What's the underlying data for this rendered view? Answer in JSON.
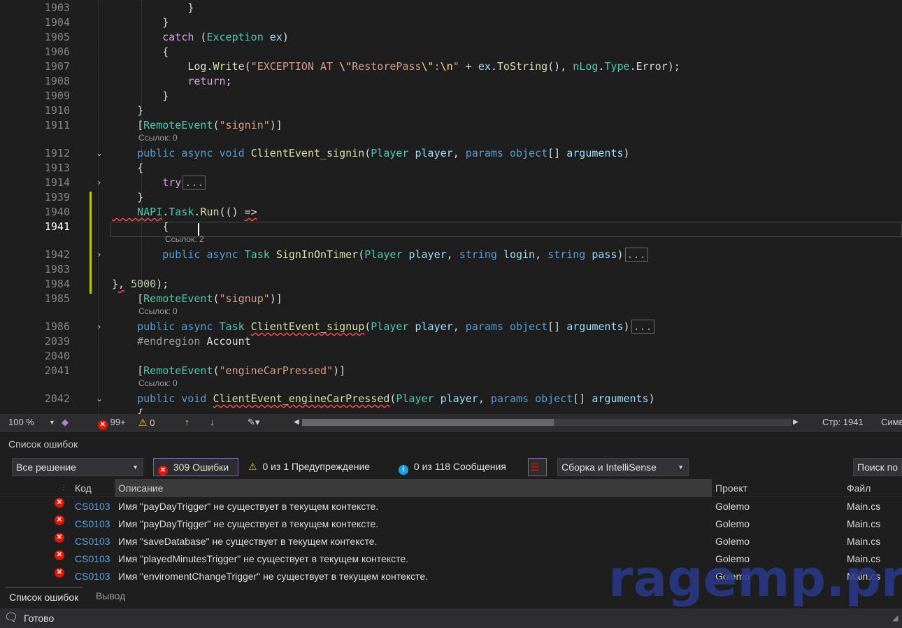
{
  "editor": {
    "lines": [
      {
        "num": "1903",
        "segments": [
          {
            "c": "w",
            "t": "            }"
          }
        ]
      },
      {
        "num": "1904",
        "segments": [
          {
            "c": "w",
            "t": "        }"
          }
        ]
      },
      {
        "num": "1905",
        "segments": [
          {
            "c": "cf",
            "t": "        catch"
          },
          {
            "c": "w",
            "t": " ("
          },
          {
            "c": "t",
            "t": "Exception"
          },
          {
            "c": "w",
            "t": " "
          },
          {
            "c": "p",
            "t": "ex"
          },
          {
            "c": "w",
            "t": ")"
          }
        ]
      },
      {
        "num": "1906",
        "segments": [
          {
            "c": "w",
            "t": "        {"
          }
        ]
      },
      {
        "num": "1907",
        "segments": [
          {
            "c": "w",
            "t": "            Log."
          },
          {
            "c": "m",
            "t": "Write"
          },
          {
            "c": "w",
            "t": "("
          },
          {
            "c": "s",
            "t": "\"EXCEPTION AT "
          },
          {
            "c": "esc",
            "t": "\\\""
          },
          {
            "c": "s",
            "t": "RestorePass"
          },
          {
            "c": "esc",
            "t": "\\\""
          },
          {
            "c": "s",
            "t": ":"
          },
          {
            "c": "esc",
            "t": "\\n"
          },
          {
            "c": "s",
            "t": "\""
          },
          {
            "c": "w",
            "t": " + "
          },
          {
            "c": "p",
            "t": "ex"
          },
          {
            "c": "w",
            "t": "."
          },
          {
            "c": "m",
            "t": "ToString"
          },
          {
            "c": "w",
            "t": "(), "
          },
          {
            "c": "t",
            "t": "nLog"
          },
          {
            "c": "w",
            "t": "."
          },
          {
            "c": "t",
            "t": "Type"
          },
          {
            "c": "w",
            "t": ".Error);"
          }
        ]
      },
      {
        "num": "1908",
        "segments": [
          {
            "c": "cf",
            "t": "            return"
          },
          {
            "c": "w",
            "t": ";"
          }
        ]
      },
      {
        "num": "1909",
        "segments": [
          {
            "c": "w",
            "t": "        }"
          }
        ]
      },
      {
        "num": "1910",
        "segments": [
          {
            "c": "w",
            "t": "    }"
          }
        ]
      },
      {
        "num": "1911",
        "segments": [
          {
            "c": "w",
            "t": "    ["
          },
          {
            "c": "t",
            "t": "RemoteEvent"
          },
          {
            "c": "w",
            "t": "("
          },
          {
            "c": "s",
            "t": "\"signin\""
          },
          {
            "c": "w",
            "t": ")]"
          }
        ]
      },
      {
        "num": "1912",
        "fold": "v",
        "segments": [
          {
            "c": "k",
            "t": "    public async void"
          },
          {
            "c": "w",
            "t": " "
          },
          {
            "c": "m",
            "t": "ClientEvent_signin"
          },
          {
            "c": "w",
            "t": "("
          },
          {
            "c": "t",
            "t": "Player"
          },
          {
            "c": "w",
            "t": " "
          },
          {
            "c": "p",
            "t": "player"
          },
          {
            "c": "w",
            "t": ", "
          },
          {
            "c": "k",
            "t": "params object"
          },
          {
            "c": "w",
            "t": "[] "
          },
          {
            "c": "p",
            "t": "arguments"
          },
          {
            "c": "w",
            "t": ")"
          }
        ]
      },
      {
        "num": "1913",
        "segments": [
          {
            "c": "w",
            "t": "    {"
          }
        ]
      },
      {
        "num": "1914",
        "fold": ">",
        "segments": [
          {
            "c": "cf",
            "t": "        try"
          },
          {
            "c": "coll",
            "t": "..."
          }
        ]
      },
      {
        "num": "1939",
        "segments": [
          {
            "c": "w",
            "t": "    }"
          }
        ]
      },
      {
        "num": "1940",
        "segments": [
          {
            "c": "t sq",
            "t": "    NAPI"
          },
          {
            "c": "w",
            "t": "."
          },
          {
            "c": "t",
            "t": "Task"
          },
          {
            "c": "w",
            "t": "."
          },
          {
            "c": "m",
            "t": "Run"
          },
          {
            "c": "w",
            "t": "(() "
          },
          {
            "c": "w sq",
            "t": "=>"
          }
        ]
      },
      {
        "num": "1941",
        "current": true,
        "segments": [
          {
            "c": "w",
            "t": "        {"
          }
        ]
      },
      {
        "num": "1942",
        "fold": ">",
        "segments": [
          {
            "c": "k",
            "t": "        public async"
          },
          {
            "c": "w",
            "t": " "
          },
          {
            "c": "t",
            "t": "Task"
          },
          {
            "c": "w",
            "t": " "
          },
          {
            "c": "m",
            "t": "SignInOnTimer"
          },
          {
            "c": "w",
            "t": "("
          },
          {
            "c": "t",
            "t": "Player"
          },
          {
            "c": "w",
            "t": " "
          },
          {
            "c": "p",
            "t": "player"
          },
          {
            "c": "w",
            "t": ", "
          },
          {
            "c": "k",
            "t": "string"
          },
          {
            "c": "w",
            "t": " "
          },
          {
            "c": "p",
            "t": "login"
          },
          {
            "c": "w",
            "t": ", "
          },
          {
            "c": "k",
            "t": "string"
          },
          {
            "c": "w",
            "t": " "
          },
          {
            "c": "p",
            "t": "pass"
          },
          {
            "c": "w",
            "t": ")"
          },
          {
            "c": "coll",
            "t": "..."
          }
        ]
      },
      {
        "num": "1983",
        "segments": [
          {
            "c": "w",
            "t": ""
          }
        ]
      },
      {
        "num": "1984",
        "segments": [
          {
            "c": "w",
            "t": "}"
          },
          {
            "c": "w sq",
            "t": ","
          },
          {
            "c": "w",
            "t": " "
          },
          {
            "c": "n",
            "t": "5000"
          },
          {
            "c": "w",
            "t": ");"
          }
        ]
      },
      {
        "num": "1985",
        "segments": [
          {
            "c": "w",
            "t": "    ["
          },
          {
            "c": "t",
            "t": "RemoteEvent"
          },
          {
            "c": "w",
            "t": "("
          },
          {
            "c": "s",
            "t": "\"signup\""
          },
          {
            "c": "w",
            "t": ")]"
          }
        ]
      },
      {
        "num": "1986",
        "fold": ">",
        "segments": [
          {
            "c": "k",
            "t": "    public async"
          },
          {
            "c": "w",
            "t": " "
          },
          {
            "c": "t",
            "t": "Task"
          },
          {
            "c": "w",
            "t": " "
          },
          {
            "c": "m sq",
            "t": "ClientEvent_signup"
          },
          {
            "c": "w",
            "t": "("
          },
          {
            "c": "t",
            "t": "Player"
          },
          {
            "c": "w",
            "t": " "
          },
          {
            "c": "p",
            "t": "player"
          },
          {
            "c": "w",
            "t": ", "
          },
          {
            "c": "k",
            "t": "params object"
          },
          {
            "c": "w",
            "t": "[] "
          },
          {
            "c": "p",
            "t": "arguments"
          },
          {
            "c": "w",
            "t": ")"
          },
          {
            "c": "coll",
            "t": "..."
          }
        ]
      },
      {
        "num": "2039",
        "segments": [
          {
            "c": "pp",
            "t": "    #endregion"
          },
          {
            "c": "w",
            "t": " Account"
          }
        ]
      },
      {
        "num": "2040",
        "segments": [
          {
            "c": "w",
            "t": ""
          }
        ]
      },
      {
        "num": "2041",
        "segments": [
          {
            "c": "w",
            "t": "    ["
          },
          {
            "c": "t",
            "t": "RemoteEvent"
          },
          {
            "c": "w",
            "t": "("
          },
          {
            "c": "s",
            "t": "\"engineCarPressed\""
          },
          {
            "c": "w",
            "t": ")]"
          }
        ]
      },
      {
        "num": "2042",
        "fold": "v",
        "segments": [
          {
            "c": "k",
            "t": "    public void"
          },
          {
            "c": "w",
            "t": " "
          },
          {
            "c": "m sq",
            "t": "ClientEvent_engineCarPressed"
          },
          {
            "c": "w",
            "t": "("
          },
          {
            "c": "t",
            "t": "Player"
          },
          {
            "c": "w",
            "t": " "
          },
          {
            "c": "p",
            "t": "player"
          },
          {
            "c": "w",
            "t": ", "
          },
          {
            "c": "k",
            "t": "params object"
          },
          {
            "c": "w",
            "t": "[] "
          },
          {
            "c": "p",
            "t": "arguments"
          },
          {
            "c": "w",
            "t": ")"
          }
        ]
      },
      {
        "num": "",
        "segments": [
          {
            "c": "w",
            "t": "    {"
          }
        ]
      }
    ],
    "lenses": [
      {
        "after": "1911",
        "text": "Ссылок: 0"
      },
      {
        "after": "1941",
        "text": "Ссылок: 2"
      },
      {
        "after": "1985",
        "text": "Ссылок: 0"
      },
      {
        "after": "2041",
        "text": "Ссылок: 0"
      }
    ]
  },
  "editor_status": {
    "zoom": "100 %",
    "errors": "99+",
    "warnings": "0",
    "position": "Стр: 1941",
    "more": "Симв"
  },
  "error_panel": {
    "title": "Список ошибок",
    "scope": "Все решение",
    "errors_btn": "309 Ошибки",
    "warnings_btn": "0 из 1 Предупреждение",
    "messages_btn": "0 из 118 Сообщения",
    "source": "Сборка и IntelliSense",
    "search": "Поиск по",
    "columns": {
      "code": "Код",
      "description": "Описание",
      "project": "Проект",
      "file": "Файл"
    },
    "rows": [
      {
        "code": "CS0103",
        "description": "Имя \"payDayTrigger\" не существует в текущем контексте.",
        "project": "Golemo",
        "file": "Main.cs"
      },
      {
        "code": "CS0103",
        "description": "Имя \"payDayTrigger\" не существует в текущем контексте.",
        "project": "Golemo",
        "file": "Main.cs"
      },
      {
        "code": "CS0103",
        "description": "Имя \"saveDatabase\" не существует в текущем контексте.",
        "project": "Golemo",
        "file": "Main.cs"
      },
      {
        "code": "CS0103",
        "description": "Имя \"playedMinutesTrigger\" не существует в текущем контексте.",
        "project": "Golemo",
        "file": "Main.cs"
      },
      {
        "code": "CS0103",
        "description": "Имя \"enviromentChangeTrigger\" не существует в текущем контексте.",
        "project": "Golemo",
        "file": "Main.cs"
      }
    ],
    "tabs": [
      "Список ошибок",
      "Вывод"
    ]
  },
  "statusbar": {
    "text": "Готово"
  },
  "watermark": "ragemp.pro",
  "colors": {
    "accent": "#7a5fbf",
    "error": "#e51400",
    "warning": "#f0c000",
    "info": "#1ba1e2"
  }
}
